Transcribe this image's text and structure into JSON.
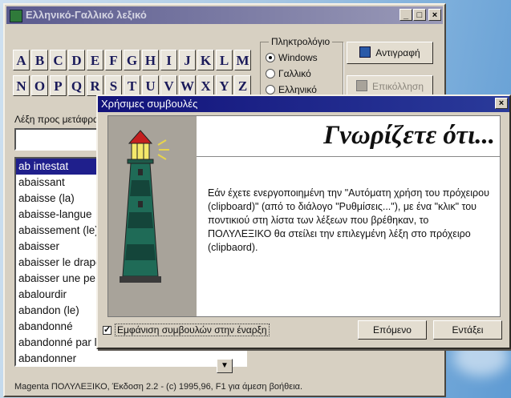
{
  "window": {
    "title": "Ελληνικό-Γαλλικό λεξικό"
  },
  "letters_row1": [
    "A",
    "B",
    "C",
    "D",
    "E",
    "F",
    "G",
    "H",
    "I",
    "J",
    "K",
    "L",
    "M"
  ],
  "letters_row2": [
    "N",
    "O",
    "P",
    "Q",
    "R",
    "S",
    "T",
    "U",
    "V",
    "W",
    "X",
    "Y",
    "Z"
  ],
  "keyboard": {
    "label": "Πληκτρολόγιο",
    "options": [
      "Windows",
      "Γαλλικό",
      "Ελληνικό"
    ],
    "selected": "Windows"
  },
  "buttons": {
    "copy": "Αντιγραφή",
    "paste": "Επικόλληση"
  },
  "input": {
    "label": "Λέξη προς μετάφραση",
    "value": ""
  },
  "word_list": [
    "ab intestat",
    "abaissant",
    "abaisse (la)",
    "abaisse-langue",
    "abaissement (le)",
    "abaisser",
    "abaisser le drapeau",
    "abaisser une perpendiculaire",
    "abalourdir",
    "abandon (le)",
    "abandonné",
    "abandonné par les médecins",
    "abandonner"
  ],
  "selected_word": "ab intestat",
  "status": "Magenta ΠΟΛΥΛΕΞΙΚΟ, Έκδοση 2.2 - (c) 1995,96, F1 για άμεση βοήθεια.",
  "tips": {
    "title": "Χρήσιμες συμβουλές",
    "heading": "Γνωρίζετε ότι...",
    "text": "Εάν έχετε ενεργοποιημένη την \"Αυτόματη χρήση του πρόχειρου (clipboard)\" (από το διάλογο \"Ρυθμίσεις...\"), με ένα \"κλικ\" του ποντικιού στη λίστα των λέξεων που βρέθηκαν, το ΠΟΛΥΛΕΞΙΚΟ θα στείλει την επιλεγμένη λέξη στο πρόχειρο (clipbaord).",
    "checkbox_label": "Εμφάνιση συμβουλών στην έναρξη",
    "checkbox_checked": true,
    "next_label": "Επόμενο",
    "close_label": "Εντάξει"
  }
}
